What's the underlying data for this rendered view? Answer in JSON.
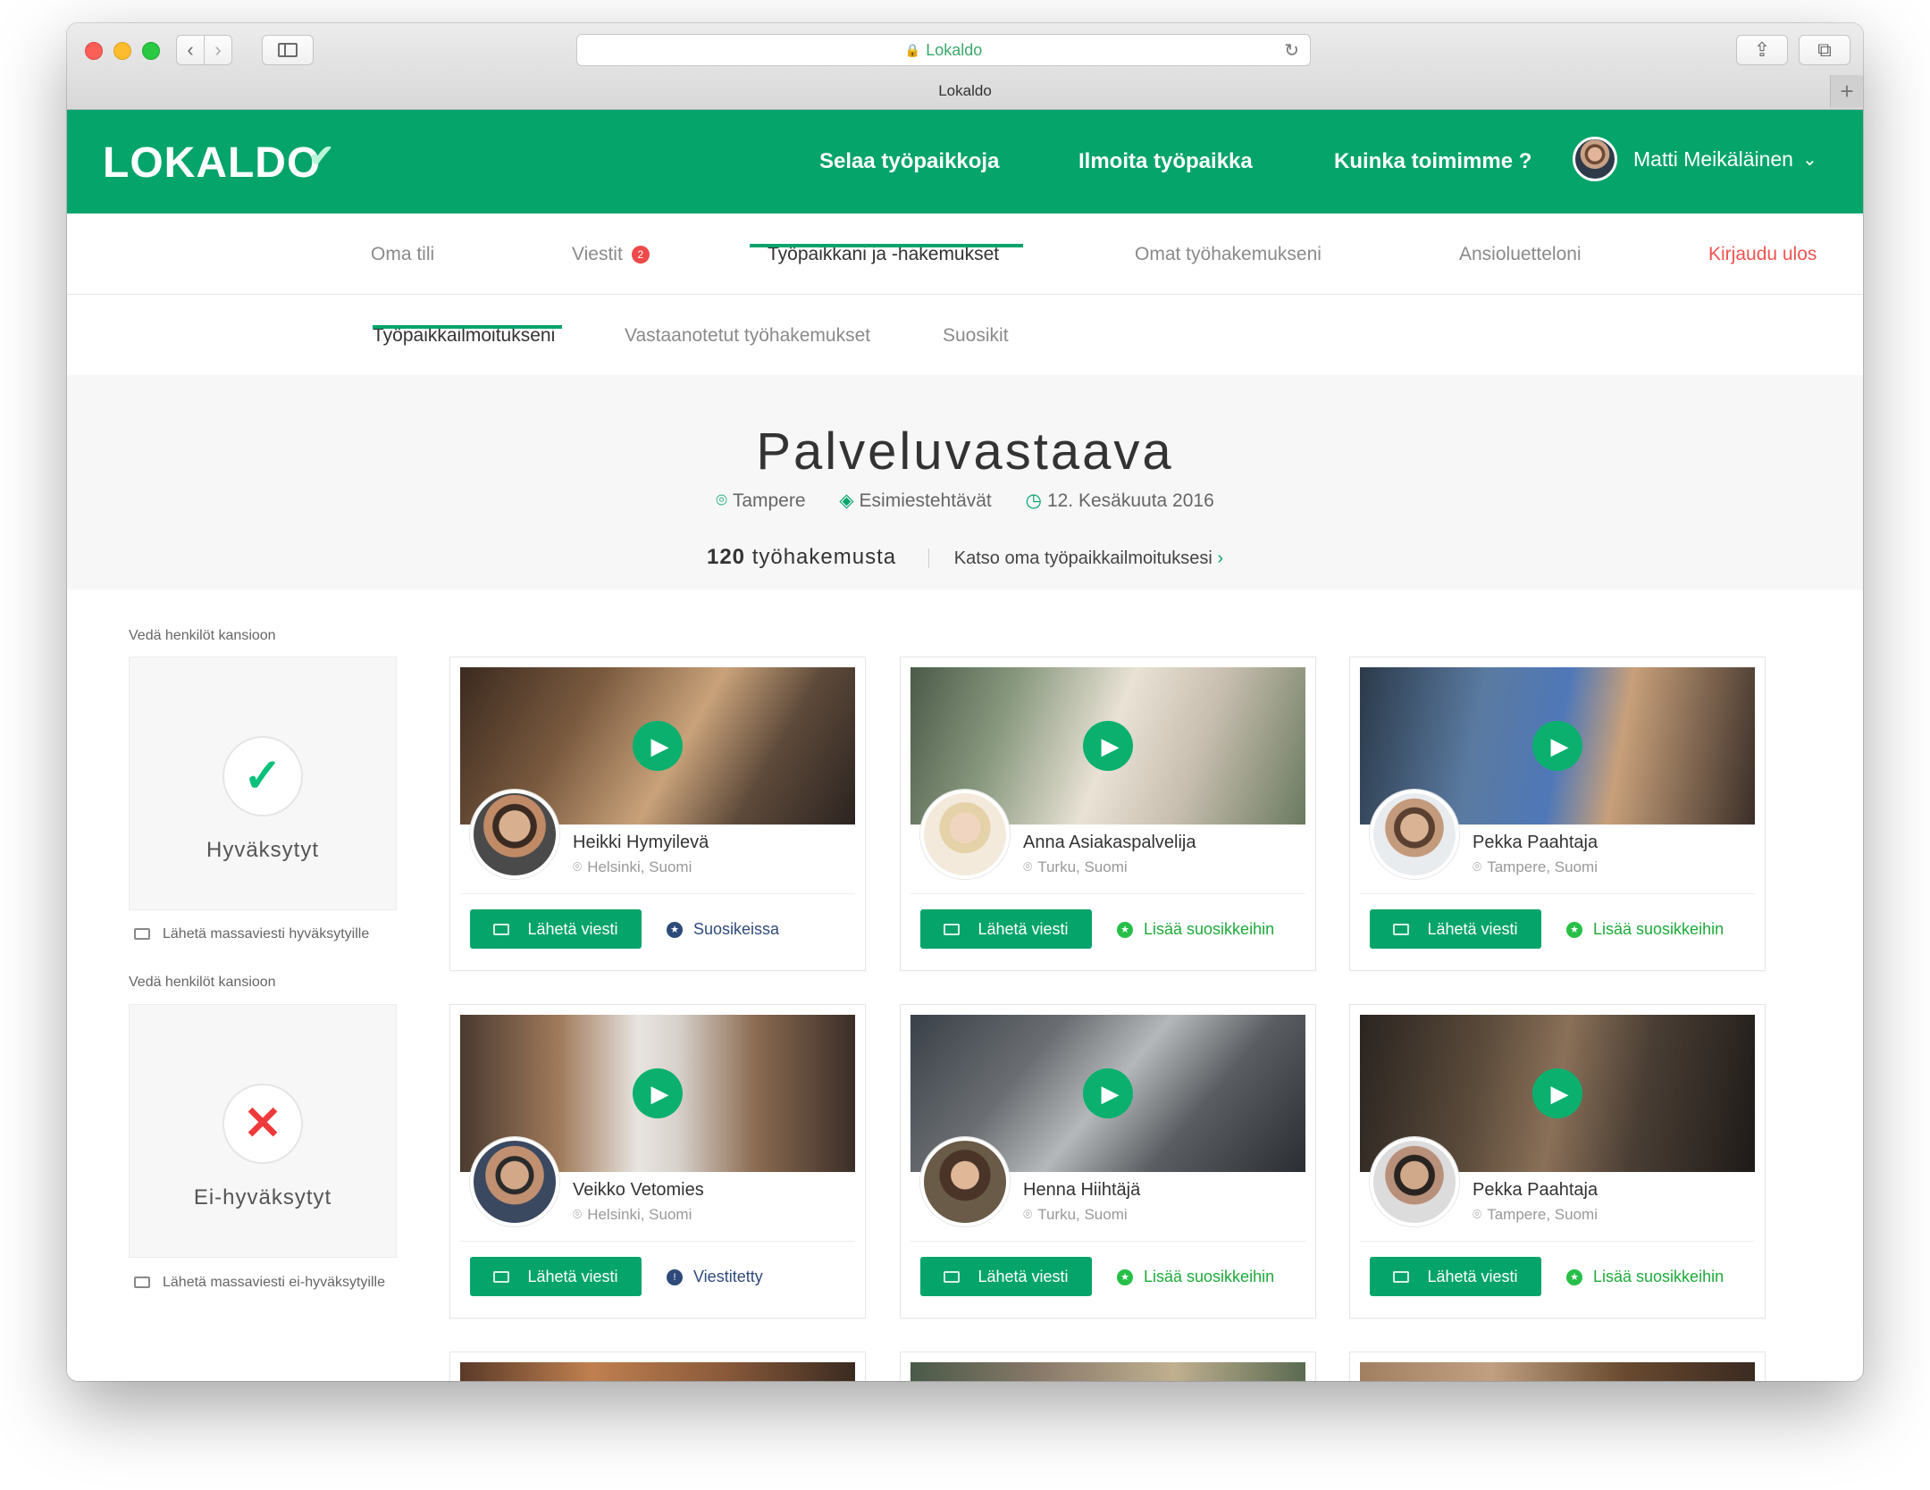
{
  "browser": {
    "address_text": "Lokaldo",
    "tab_title": "Lokaldo"
  },
  "header": {
    "logo": "LOKALDO",
    "nav": [
      "Selaa työpaikkoja",
      "Ilmoita työpaikka",
      "Kuinka toimimme ?"
    ],
    "user_name": "Matti Meikäläinen"
  },
  "subnav": {
    "items": [
      "Oma tili",
      "Viestit",
      "Työpaikkani ja -hakemukset",
      "Omat työhakemukseni",
      "Ansioluetteloni"
    ],
    "messages_badge": "2",
    "logout": "Kirjaudu ulos",
    "active_index": 2
  },
  "subnav2": {
    "items": [
      "Työpaikkailmoitukseni",
      "Vastaanotetut työhakemukset",
      "Suosikit"
    ],
    "active_index": 0
  },
  "job": {
    "title": "Palveluvastaava",
    "location": "Tampere",
    "category": "Esimiestehtävät",
    "date": "12. Kesäkuuta 2016",
    "applications_count": "120",
    "applications_label": "työhakemusta",
    "view_link": "Katso oma työpaikkailmoituksesi"
  },
  "folders": [
    {
      "label": "Vedä henkilöt kansioon",
      "name": "Hyväksytyt",
      "mass_message": "Lähetä massaviesti hyväksytyille"
    },
    {
      "label": "Vedä henkilöt kansioon",
      "name": "Ei-hyväksytyt",
      "mass_message": "Lähetä massaviesti ei-hyväksytyille"
    }
  ],
  "send_label": "Lähetä viesti",
  "applicants": [
    {
      "name": "Heikki Hymyilevä",
      "location": "Helsinki, Suomi",
      "status": "Suosikeissa",
      "status_type": "fav"
    },
    {
      "name": "Anna Asiakaspalvelija",
      "location": "Turku, Suomi",
      "status": "Lisää suosikkeihin",
      "status_type": "add"
    },
    {
      "name": "Pekka Paahtaja",
      "location": "Tampere, Suomi",
      "status": "Lisää suosikkeihin",
      "status_type": "add"
    },
    {
      "name": "Veikko Vetomies",
      "location": "Helsinki, Suomi",
      "status": "Viestitetty",
      "status_type": "fav"
    },
    {
      "name": "Henna Hiihtäjä",
      "location": "Turku, Suomi",
      "status": "Lisää suosikkeihin",
      "status_type": "add"
    },
    {
      "name": "Pekka Paahtaja",
      "location": "Tampere, Suomi",
      "status": "Lisää suosikkeihin",
      "status_type": "add"
    }
  ],
  "colors": {
    "brand": "#04a46b",
    "logout": "#ef5350",
    "favorite": "#2e4a7a",
    "add_favorite": "#1daa3a"
  }
}
